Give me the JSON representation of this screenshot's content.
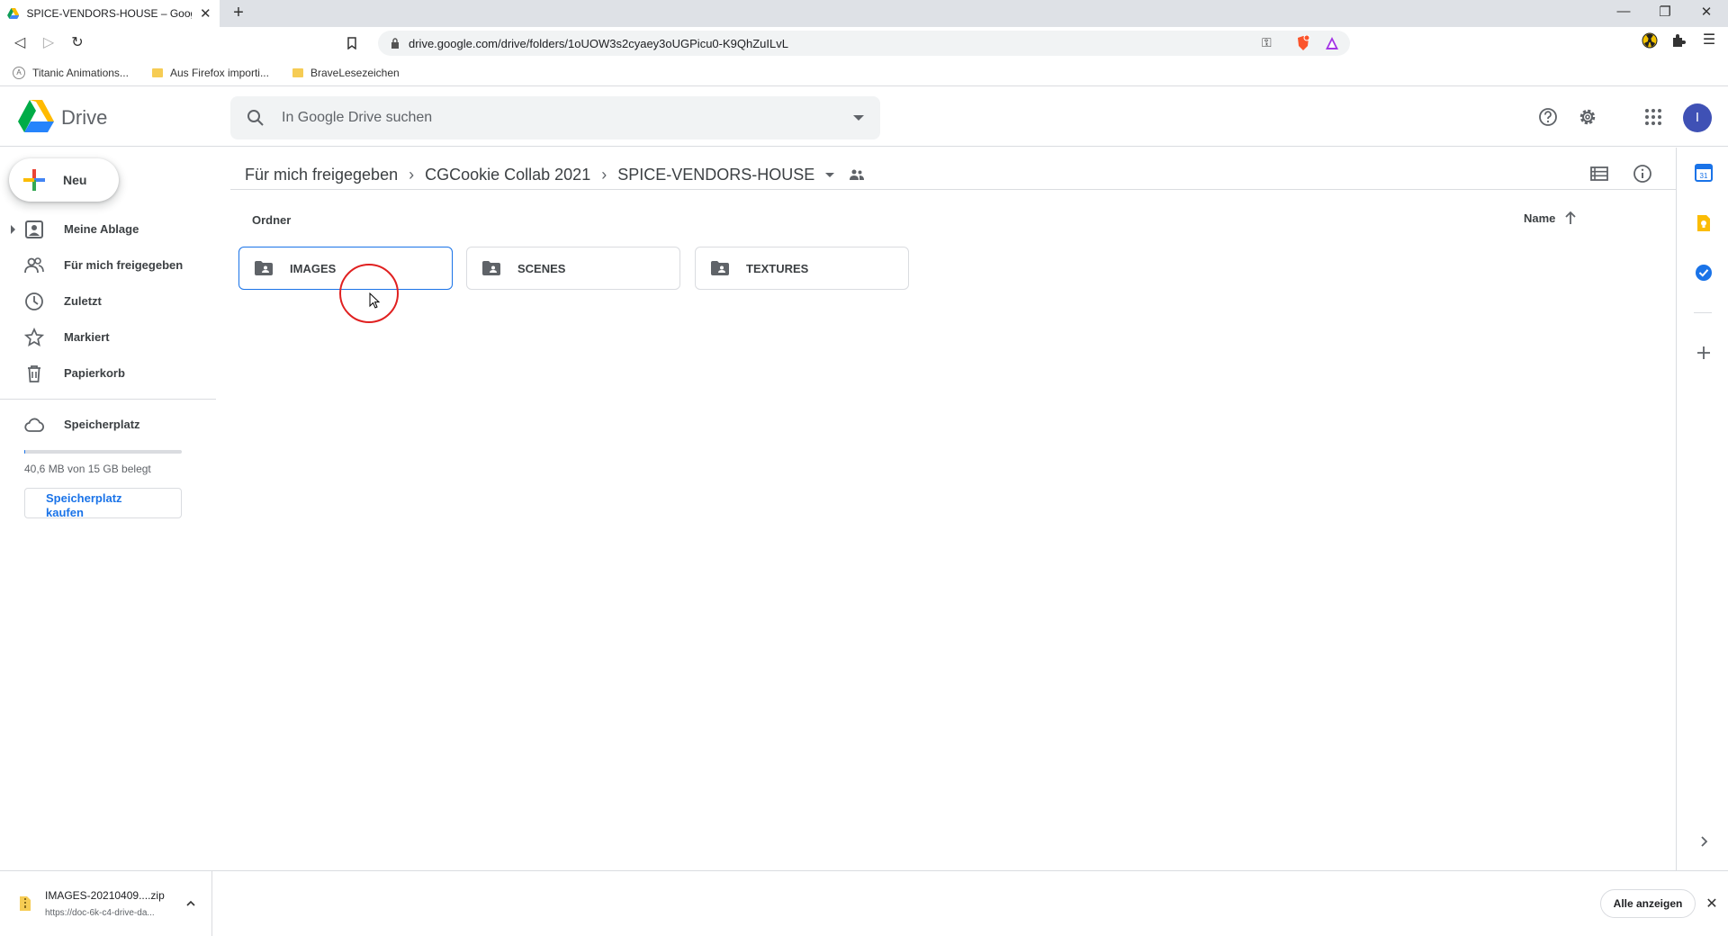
{
  "browser": {
    "tab_title": "SPICE-VENDORS-HOUSE – Google",
    "url": "drive.google.com/drive/folders/1oUOW3s2cyaey3oUGPicu0-K9QhZuILvL",
    "bookmarks": [
      {
        "label": "Titanic Animations...",
        "icon": "globe-icon"
      },
      {
        "label": "Aus Firefox importi...",
        "icon": "folder-icon"
      },
      {
        "label": "BraveLesezeichen",
        "icon": "folder-icon"
      }
    ]
  },
  "drive": {
    "app_name": "Drive",
    "search_placeholder": "In Google Drive suchen",
    "avatar_letter": "I",
    "new_label": "Neu",
    "nav": [
      {
        "label": "Meine Ablage",
        "icon": "my-drive-icon"
      },
      {
        "label": "Für mich freigegeben",
        "icon": "shared-icon"
      },
      {
        "label": "Zuletzt",
        "icon": "clock-icon"
      },
      {
        "label": "Markiert",
        "icon": "star-icon"
      },
      {
        "label": "Papierkorb",
        "icon": "trash-icon"
      }
    ],
    "storage": {
      "label": "Speicherplatz",
      "used_text": "40,6 MB von 15 GB belegt",
      "used_fraction": 0.003,
      "buy_label_line1": "Speicherplatz",
      "buy_label_line2": "kaufen"
    },
    "breadcrumbs": [
      "Für mich freigegeben",
      "CGCookie Collab 2021",
      "SPICE-VENDORS-HOUSE"
    ],
    "section_title": "Ordner",
    "sort_label": "Name",
    "folders": [
      {
        "name": "IMAGES",
        "selected": true
      },
      {
        "name": "SCENES",
        "selected": false
      },
      {
        "name": "TEXTURES",
        "selected": false
      }
    ]
  },
  "download": {
    "file_name": "IMAGES-20210409....zip",
    "file_url": "https://doc-6k-c4-drive-da...",
    "show_all_label": "Alle anzeigen"
  },
  "colors": {
    "accent": "#1a73e8",
    "avatar": "#3f51b5",
    "cursor_ring": "#e02020"
  }
}
